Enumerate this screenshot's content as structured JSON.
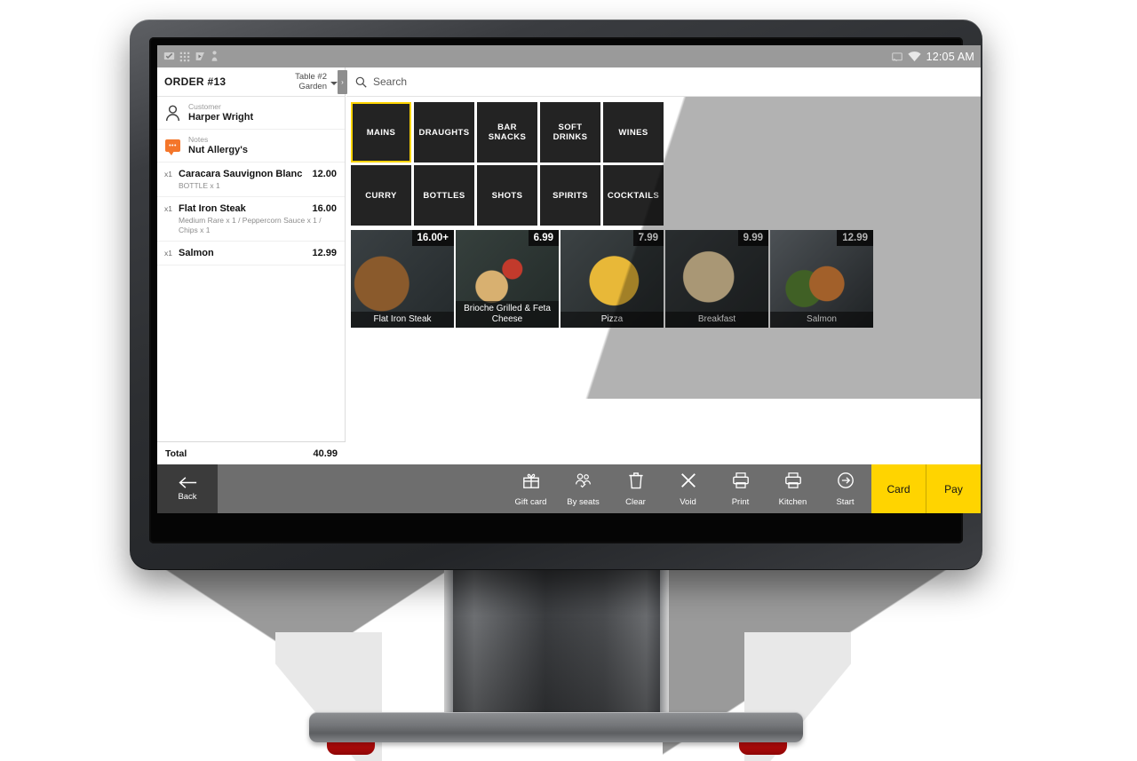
{
  "status_bar": {
    "left_icons": [
      "screen-cast-icon",
      "grid-icon",
      "play-cast-icon",
      "person-icon"
    ],
    "right_icons": [
      "cast-icon",
      "wifi-icon"
    ],
    "time": "12:05 AM"
  },
  "order": {
    "id_label": "ORDER #13",
    "table_line1": "Table #2",
    "table_line2": "Garden",
    "customer_label": "Customer",
    "customer_name": "Harper Wright",
    "notes_label": "Notes",
    "notes_value": "Nut Allergy's",
    "items": [
      {
        "qty": "x1",
        "name": "Caracara Sauvignon Blanc",
        "price": "12.00",
        "modifiers": "BOTTLE x 1"
      },
      {
        "qty": "x1",
        "name": "Flat Iron Steak",
        "price": "16.00",
        "modifiers": "Medium Rare x 1 / Peppercorn Sauce x 1 / Chips x 1"
      },
      {
        "qty": "x1",
        "name": "Salmon",
        "price": "12.99",
        "modifiers": ""
      }
    ],
    "total_label": "Total",
    "total_value": "40.99"
  },
  "search": {
    "placeholder": "Search",
    "icon": "search-icon"
  },
  "categories": [
    {
      "label": "MAINS",
      "selected": true
    },
    {
      "label": "DRAUGHTS",
      "selected": false
    },
    {
      "label": "BAR SNACKS",
      "selected": false
    },
    {
      "label": "SOFT DRINKS",
      "selected": false
    },
    {
      "label": "WINES",
      "selected": false
    },
    {
      "label": "CURRY",
      "selected": false
    },
    {
      "label": "BOTTLES",
      "selected": false
    },
    {
      "label": "SHOTS",
      "selected": false
    },
    {
      "label": "SPIRITS",
      "selected": false
    },
    {
      "label": "COCKTAILS",
      "selected": false
    }
  ],
  "products": [
    {
      "name": "Flat Iron Steak",
      "price": "16.00+"
    },
    {
      "name": "Brioche Grilled & Feta Cheese",
      "price": "6.99"
    },
    {
      "name": "Pizza",
      "price": "7.99"
    },
    {
      "name": "Breakfast",
      "price": "9.99"
    },
    {
      "name": "Salmon",
      "price": "12.99"
    }
  ],
  "toolbar": {
    "back_label": "Back",
    "actions": [
      {
        "label": "Gift card",
        "icon": "gift-icon"
      },
      {
        "label": "By seats",
        "icon": "people-icon"
      },
      {
        "label": "Clear",
        "icon": "trash-icon"
      },
      {
        "label": "Void",
        "icon": "close-icon"
      },
      {
        "label": "Print",
        "icon": "printer-icon"
      },
      {
        "label": "Kitchen",
        "icon": "printer-icon"
      },
      {
        "label": "Start",
        "icon": "arrow-circle-icon"
      }
    ],
    "card_label": "Card",
    "pay_label": "Pay"
  },
  "nav_bar": {
    "items": [
      "volume-down-icon",
      "back-icon",
      "home-icon",
      "recents-icon",
      "volume-up-icon"
    ]
  },
  "colors": {
    "accent_yellow": "#ffd400",
    "tile_dark": "#232323",
    "toolbar_gray": "#6e6e6e",
    "notes_orange": "#f4762a"
  }
}
